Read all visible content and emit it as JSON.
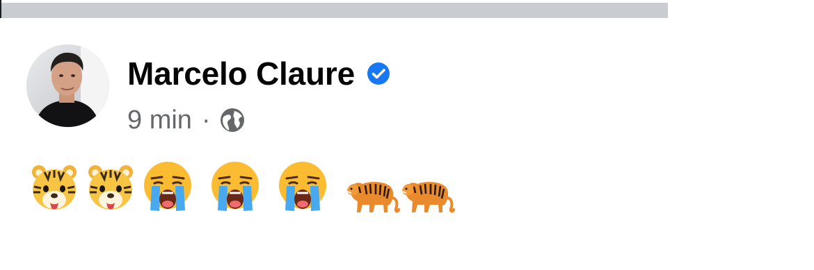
{
  "post": {
    "author": {
      "name": "Marcelo Claure",
      "verified": true
    },
    "meta": {
      "timestamp": "9 min",
      "separator": "·",
      "audience_icon": "globe-icon"
    },
    "content": {
      "emojis": [
        "tiger-face-emoji",
        "tiger-face-emoji",
        "loudly-crying-face-emoji",
        "loudly-crying-face-emoji",
        "loudly-crying-face-emoji",
        "tiger-emoji",
        "tiger-emoji"
      ]
    }
  },
  "colors": {
    "top_bar": "#c9ccd1",
    "name_text": "#050505",
    "meta_text": "#65676b",
    "verified_badge": "#1877f2"
  }
}
